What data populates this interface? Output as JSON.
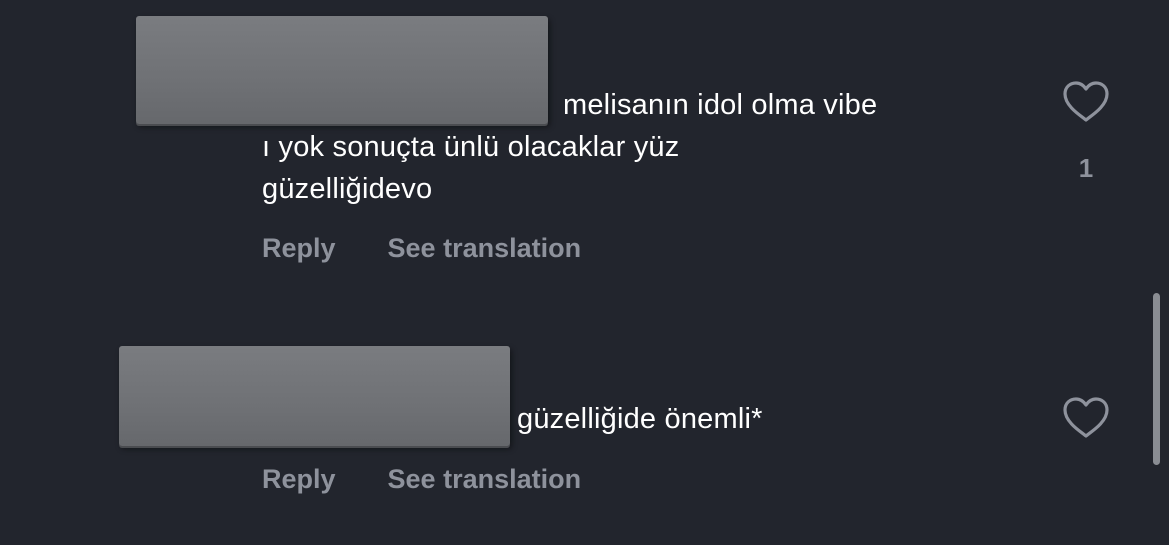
{
  "comments": [
    {
      "first_line": "melisanın idol olma vibe",
      "rest": "ı yok sonuçta ünlü olacaklar yüz\ngüzelliğidevo",
      "reply_label": "Reply",
      "translate_label": "See translation",
      "like_icon": "heart-outline-icon",
      "like_count": "1"
    },
    {
      "first_line": "güzelliğide önemli*",
      "reply_label": "Reply",
      "translate_label": "See translation",
      "like_icon": "heart-outline-icon"
    }
  ],
  "colors": {
    "background": "#22252d",
    "text": "#ffffff",
    "muted": "#8e929c",
    "redaction": "#6f7175"
  }
}
